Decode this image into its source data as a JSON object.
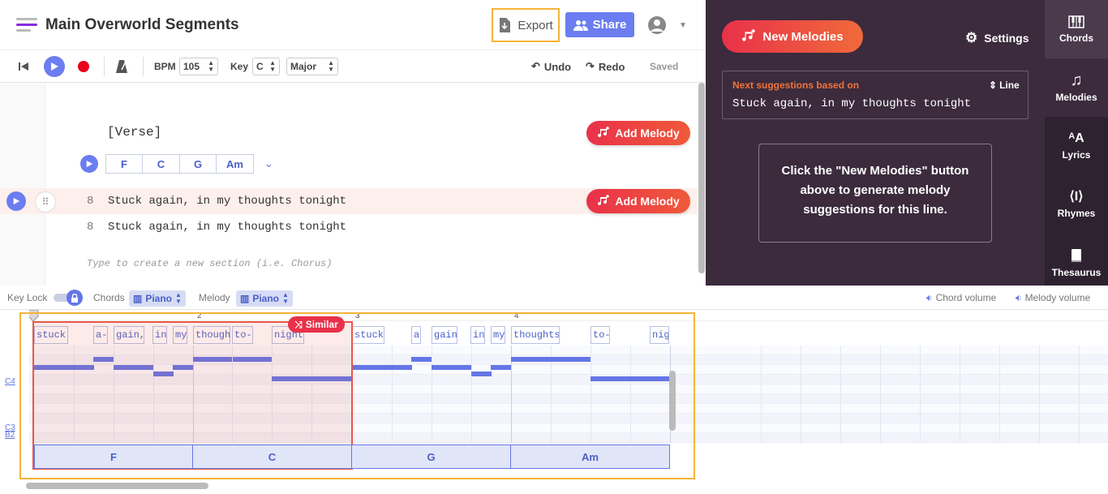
{
  "header": {
    "title": "Main Overworld Segments",
    "export_label": "Export",
    "share_label": "Share"
  },
  "toolbar": {
    "bpm_label": "BPM",
    "bpm_value": "105",
    "key_label": "Key",
    "key_value": "C",
    "mode_value": "Major",
    "undo_label": "Undo",
    "redo_label": "Redo",
    "saved_label": "Saved"
  },
  "editor": {
    "section_label": "[Verse]",
    "add_melody_label": "Add Melody",
    "chords": [
      "F",
      "C",
      "G",
      "Am"
    ],
    "lines": [
      {
        "num": "8",
        "text": "Stuck again, in my thoughts tonight"
      },
      {
        "num": "8",
        "text": "Stuck again, in my thoughts tonight"
      }
    ],
    "new_section_placeholder": "Type to create a new section (i.e. Chorus)"
  },
  "panel": {
    "new_melodies_label": "New Melodies",
    "settings_label": "Settings",
    "suggestion_header": "Next suggestions based on",
    "suggestion_scope": "Line",
    "suggestion_text": "Stuck again, in my thoughts tonight",
    "info_text": "Click the \"New Melodies\" button above to generate melody suggestions for this line."
  },
  "sidebar": {
    "tabs": [
      {
        "label": "Chords",
        "icon": "piano-icon"
      },
      {
        "label": "Melodies",
        "icon": "music-note-icon"
      },
      {
        "label": "Lyrics",
        "icon": "text-size-icon"
      },
      {
        "label": "Rhymes",
        "icon": "rhymes-icon"
      },
      {
        "label": "Thesaurus",
        "icon": "book-icon"
      }
    ]
  },
  "mixer": {
    "key_lock_label": "Key Lock",
    "chords_label": "Chords",
    "chords_instrument": "Piano",
    "melody_label": "Melody",
    "melody_instrument": "Piano",
    "chord_volume_label": "Chord volume",
    "melody_volume_label": "Melody volume"
  },
  "roll": {
    "similar_label": "Similar",
    "measures": [
      "2",
      "3",
      "4"
    ],
    "key_labels": [
      "C4",
      "C3",
      "B2"
    ],
    "lyrics": [
      "stuck",
      "a-",
      "gain,",
      "in",
      "my",
      "though",
      "to-",
      "night",
      "stuck",
      "a",
      "gain",
      "in",
      "my",
      "thoughts",
      "to-",
      "nig"
    ],
    "chord_bars": [
      "F",
      "C",
      "G",
      "Am"
    ]
  },
  "colors": {
    "accent": "#6b7df0",
    "brand_red": "#e9314a",
    "highlight": "#f5b43a",
    "panel_bg": "#3b2b3d"
  }
}
